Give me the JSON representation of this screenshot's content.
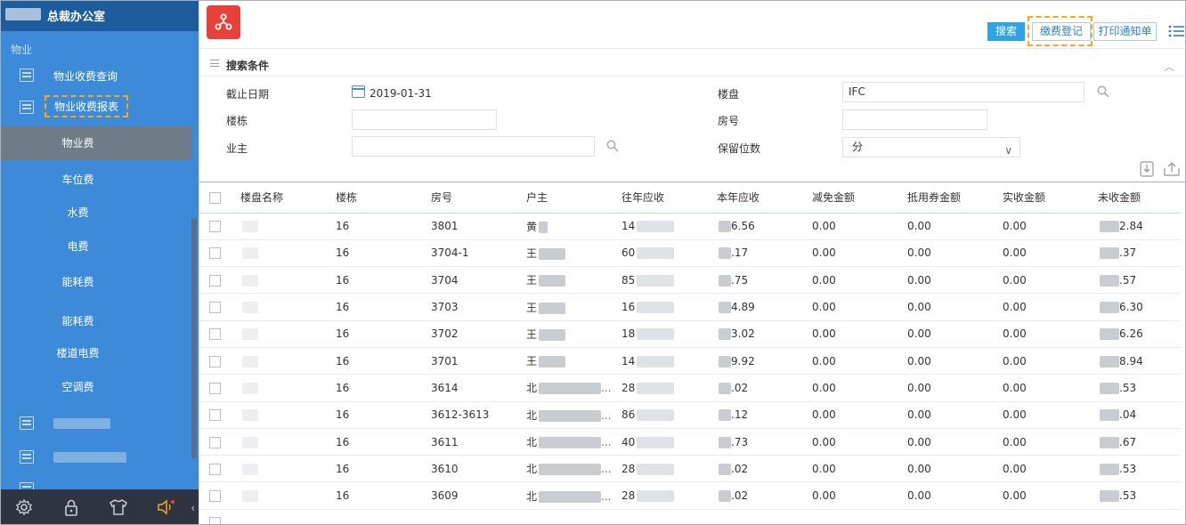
{
  "sidebar": {
    "office_title": "总裁办公室",
    "section": "物业",
    "menu": [
      {
        "label": "物业收费查询"
      },
      {
        "label": "物业收费报表"
      }
    ],
    "submenu": [
      "物业费",
      "车位费",
      "水费",
      "电费",
      "能耗费",
      "能耗费",
      "楼道电费",
      "空调费"
    ],
    "active_submenu": "物业费"
  },
  "toolbar": {
    "search": "搜索",
    "pay_register": "缴费登记",
    "print_notice": "打印通知单"
  },
  "conditions": {
    "title": "搜索条件",
    "cutoff_label": "截止日期",
    "cutoff_value": "2019-01-31",
    "property_label": "楼盘",
    "property_value": "IFC",
    "building_label": "楼栋",
    "room_label": "房号",
    "owner_label": "业主",
    "precision_label": "保留位数",
    "precision_value": "分"
  },
  "table": {
    "columns": [
      "楼盘名称",
      "楼栋",
      "房号",
      "户主",
      "往年应收",
      "本年应收",
      "减免金额",
      "抵用券金额",
      "实收金额",
      "未收金额"
    ],
    "rows": [
      {
        "building": "16",
        "room": "3801",
        "owner": "黄",
        "prev": "14",
        "cur": "6.56",
        "reduce": "0.00",
        "voucher": "0.00",
        "paid": "0.00",
        "unpaid": "2.84"
      },
      {
        "building": "16",
        "room": "3704-1",
        "owner": "王",
        "prev": "60",
        "cur": ".17",
        "reduce": "0.00",
        "voucher": "0.00",
        "paid": "0.00",
        "unpaid": ".37"
      },
      {
        "building": "16",
        "room": "3704",
        "owner": "王",
        "prev": "85",
        "cur": ".75",
        "reduce": "0.00",
        "voucher": "0.00",
        "paid": "0.00",
        "unpaid": ".57"
      },
      {
        "building": "16",
        "room": "3703",
        "owner": "王",
        "prev": "16",
        "cur": "4.89",
        "reduce": "0.00",
        "voucher": "0.00",
        "paid": "0.00",
        "unpaid": "6.30"
      },
      {
        "building": "16",
        "room": "3702",
        "owner": "王",
        "prev": "18",
        "cur": "3.02",
        "reduce": "0.00",
        "voucher": "0.00",
        "paid": "0.00",
        "unpaid": "6.26"
      },
      {
        "building": "16",
        "room": "3701",
        "owner": "王",
        "prev": "14",
        "cur": "9.92",
        "reduce": "0.00",
        "voucher": "0.00",
        "paid": "0.00",
        "unpaid": "8.94"
      },
      {
        "building": "16",
        "room": "3614",
        "owner": "北",
        "prev": "28",
        "cur": ".02",
        "reduce": "0.00",
        "voucher": "0.00",
        "paid": "0.00",
        "unpaid": ".53"
      },
      {
        "building": "16",
        "room": "3612-3613",
        "owner": "北",
        "prev": "86",
        "cur": ".12",
        "reduce": "0.00",
        "voucher": "0.00",
        "paid": "0.00",
        "unpaid": ".04"
      },
      {
        "building": "16",
        "room": "3611",
        "owner": "北",
        "prev": "40",
        "cur": ".73",
        "reduce": "0.00",
        "voucher": "0.00",
        "paid": "0.00",
        "unpaid": ".67"
      },
      {
        "building": "16",
        "room": "3610",
        "owner": "北",
        "prev": "28",
        "cur": ".02",
        "reduce": "0.00",
        "voucher": "0.00",
        "paid": "0.00",
        "unpaid": ".53"
      },
      {
        "building": "16",
        "room": "3609",
        "owner": "北",
        "prev": "28",
        "cur": ".02",
        "reduce": "0.00",
        "voucher": "0.00",
        "paid": "0.00",
        "unpaid": ".53"
      }
    ]
  }
}
